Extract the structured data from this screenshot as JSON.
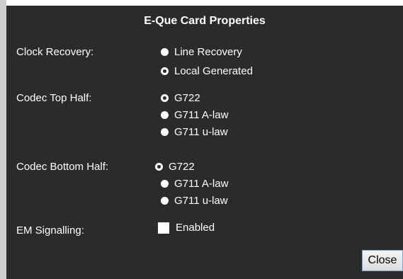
{
  "dialog": {
    "title": "E-Que Card Properties",
    "close_label": "Close"
  },
  "clock_recovery": {
    "label": "Clock Recovery:",
    "options": [
      "Line Recovery",
      "Local Generated"
    ],
    "selected": "Local Generated"
  },
  "codec_top": {
    "label": "Codec Top Half:",
    "options": [
      "G722",
      "G711 A-law",
      "G711 u-law"
    ],
    "selected": "G722"
  },
  "codec_bottom": {
    "label": "Codec Bottom Half:",
    "options": [
      "G722",
      "G711 A-law",
      "G711 u-law"
    ],
    "selected": "G722"
  },
  "em_signalling": {
    "label": "EM Signalling:",
    "checkbox_label": "Enabled",
    "checked": false
  },
  "colors": {
    "dialog_background": "#2b2b2b",
    "text": "#ffffff",
    "button_border": "#7aa7d6"
  }
}
